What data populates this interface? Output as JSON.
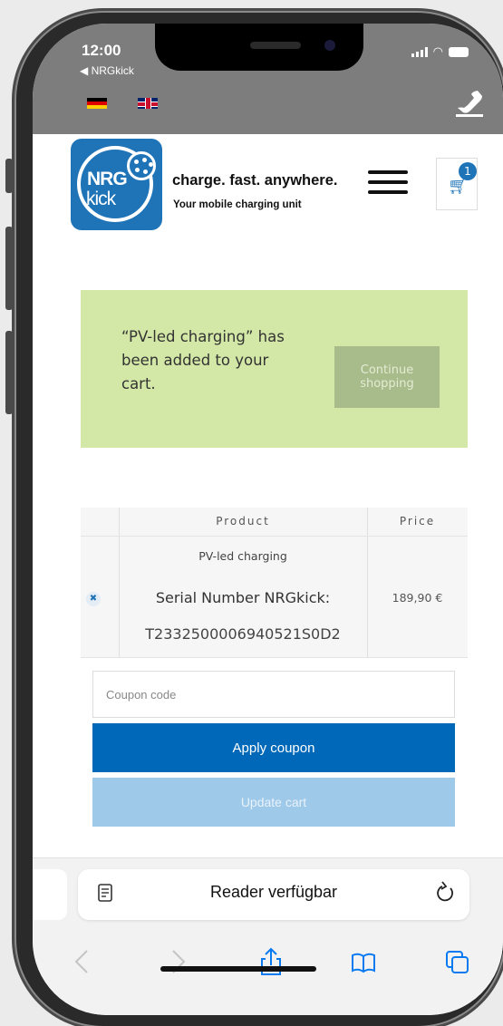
{
  "status_bar": {
    "time": "12:00",
    "back_link": "◀ NRGkick"
  },
  "site_header": {
    "logo_line1": "NRG",
    "logo_line2": "kick",
    "tagline": "charge. fast. anywhere.",
    "subtagline": "Your mobile charging unit",
    "cart_count": "1"
  },
  "notice": {
    "message": "“PV-led charging” has been added to your cart.",
    "continue_label": "Continue shopping"
  },
  "cart_table": {
    "headers": [
      "Product",
      "Price"
    ],
    "items": [
      {
        "name": "PV-led charging",
        "serial_label": "Serial Number NRGkick:",
        "serial_value": "T2332500006940521S0D2",
        "price": "189,90 €"
      }
    ]
  },
  "coupon": {
    "placeholder": "Coupon code",
    "apply_label": "Apply coupon"
  },
  "update_label": "Update cart",
  "safari": {
    "address_text": "Reader verfügbar"
  },
  "colors": {
    "brand_blue": "#1f74b8",
    "button_blue": "#0068b8",
    "notice_green": "#d3e8a6"
  }
}
